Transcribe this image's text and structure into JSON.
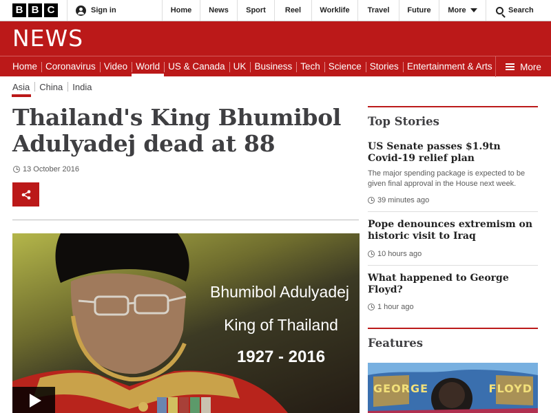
{
  "topbar": {
    "logo_letters": [
      "B",
      "B",
      "C"
    ],
    "signin_label": "Sign in",
    "links": [
      "Home",
      "News",
      "Sport",
      "Reel",
      "Worklife",
      "Travel",
      "Future"
    ],
    "more_label": "More",
    "search_label": "Search"
  },
  "masthead": {
    "title": "NEWS"
  },
  "section_nav": {
    "items": [
      "Home",
      "Coronavirus",
      "Video",
      "World",
      "US & Canada",
      "UK",
      "Business",
      "Tech",
      "Science",
      "Stories",
      "Entertainment & Arts"
    ],
    "active": "World",
    "more_label": "More"
  },
  "sub_nav": {
    "items": [
      "Asia",
      "China",
      "India"
    ],
    "active": "Asia"
  },
  "article": {
    "headline": "Thailand's King Bhumibol Adulyadej dead at 88",
    "date": "13 October 2016",
    "video_overlay": {
      "name": "Bhumibol Adulyadej",
      "title": "King of Thailand",
      "years": "1927 - 2016"
    }
  },
  "sidebar": {
    "top_stories_heading": "Top Stories",
    "stories": [
      {
        "title": "US Senate passes $1.9tn Covid-19 relief plan",
        "summary": "The major spending package is expected to be given final approval in the House next week.",
        "time": "39 minutes ago"
      },
      {
        "title": "Pope denounces extremism on historic visit to Iraq",
        "summary": "",
        "time": "10 hours ago"
      },
      {
        "title": "What happened to George Floyd?",
        "summary": "",
        "time": "1 hour ago"
      }
    ],
    "features_heading": "Features",
    "feature_image_text": "GEORGE FLOYD"
  },
  "colors": {
    "brand_red": "#bb1919",
    "text_dark": "#3f3f42"
  }
}
